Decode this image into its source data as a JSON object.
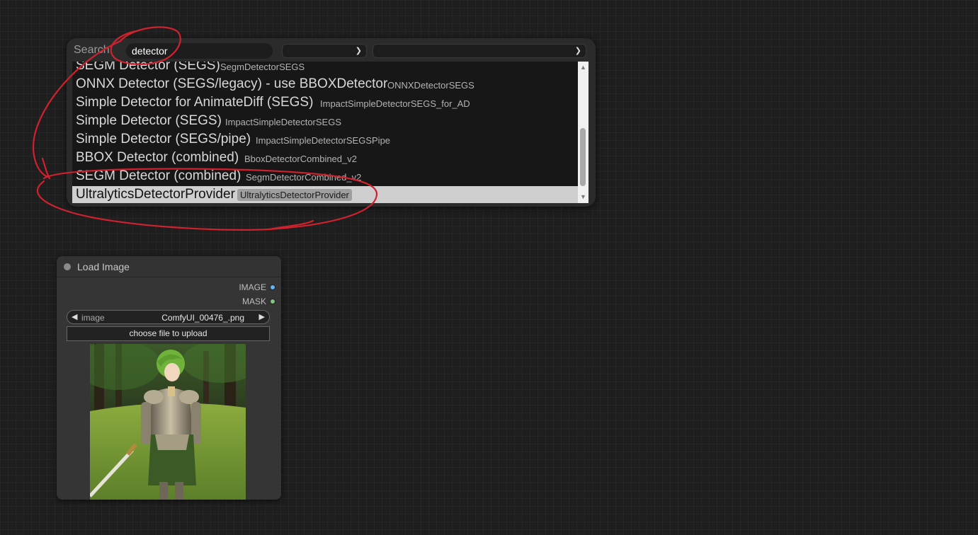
{
  "search": {
    "label": "Search:",
    "query": "detector"
  },
  "results": [
    {
      "name": "SEGM Detector (SEGS)",
      "type": "SegmDetectorSEGS"
    },
    {
      "name": "ONNX Detector (SEGS/legacy) - use BBOXDetector",
      "type": "ONNXDetectorSEGS"
    },
    {
      "name": "Simple Detector for AnimateDiff (SEGS)",
      "type": "ImpactSimpleDetectorSEGS_for_AD"
    },
    {
      "name": "Simple Detector (SEGS)",
      "type": "ImpactSimpleDetectorSEGS"
    },
    {
      "name": "Simple Detector (SEGS/pipe)",
      "type": "ImpactSimpleDetectorSEGSPipe"
    },
    {
      "name": "BBOX Detector (combined)",
      "type": "BboxDetectorCombined_v2"
    },
    {
      "name": "SEGM Detector (combined)",
      "type": "SegmDetectorCombined_v2"
    },
    {
      "name": "UltralyticsDetectorProvider",
      "type": "UltralyticsDetectorProvider"
    }
  ],
  "selected_result_index": 7,
  "node": {
    "title": "Load Image",
    "outputs": [
      {
        "label": "IMAGE",
        "color": "#64b5f6"
      },
      {
        "label": "MASK",
        "color": "#81c784"
      }
    ],
    "image_widget": {
      "label": "image",
      "value": "ComfyUI_00476_.png"
    },
    "upload_label": "choose file to upload"
  },
  "colors": {
    "annotation": "#d0222e",
    "selected_row": "#cfcfcf"
  }
}
